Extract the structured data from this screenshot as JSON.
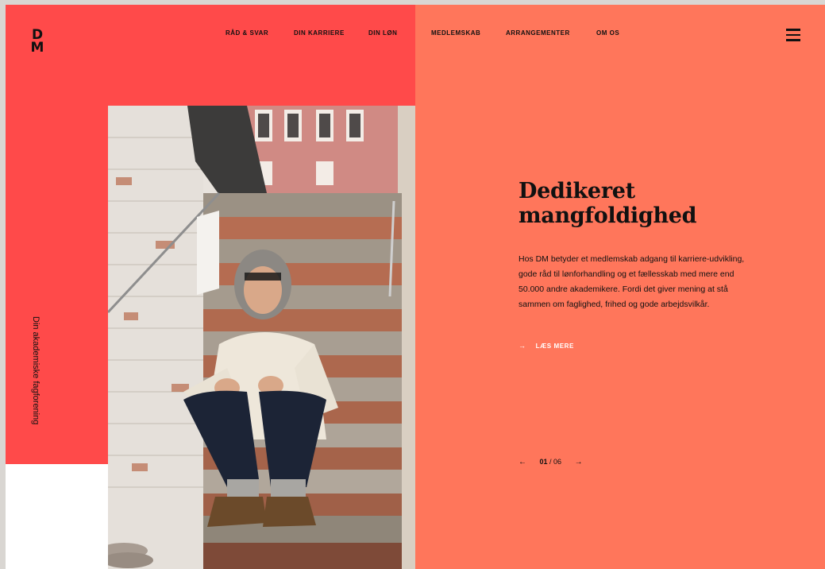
{
  "brand": {
    "logo_line1": "D",
    "logo_line2": "M"
  },
  "nav": {
    "items": [
      {
        "label": "RÅD & SVAR"
      },
      {
        "label": "DIN KARRIERE"
      },
      {
        "label": "DIN LØN"
      },
      {
        "label": "MEDLEMSKAB"
      },
      {
        "label": "ARRANGEMENTER"
      },
      {
        "label": "OM OS"
      }
    ]
  },
  "tagline": "Din akademiske fagforening",
  "hero": {
    "headline_line1": "Dedikeret",
    "headline_line2": "mangfoldighed",
    "body": "Hos DM betyder et medlemskab adgang til karriere-udvikling, gode råd til lønforhandling og et fællesskab med mere end 50.000 andre akademikere. Fordi det giver mening at stå sammen om faglighed, frihed og gode arbejdsvilkår.",
    "read_more": "LÆS MERE",
    "read_more_arrow": "→"
  },
  "pager": {
    "prev": "←",
    "current": "01",
    "separator": " / ",
    "total": "06",
    "next": "→"
  },
  "colors": {
    "red": "#ff4a4a",
    "salmon": "#ff765b",
    "text": "#111111"
  },
  "icons": {
    "menu": "hamburger-menu-icon",
    "prev": "arrow-left-icon",
    "next": "arrow-right-icon"
  }
}
